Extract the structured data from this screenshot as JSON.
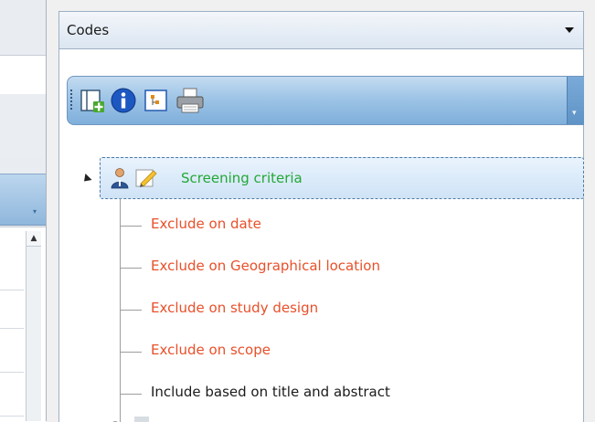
{
  "codes_panel": {
    "title": "Codes",
    "toolbar": [
      {
        "icon": "add-code-icon"
      },
      {
        "icon": "info-icon"
      },
      {
        "icon": "tree-view-icon"
      },
      {
        "icon": "print-icon"
      }
    ],
    "tree": {
      "root": {
        "label": "Screening criteria",
        "color": "#22a836"
      },
      "children": [
        {
          "label": "Exclude on date",
          "color": "#e8502a"
        },
        {
          "label": "Exclude on Geographical location",
          "color": "#e8502a"
        },
        {
          "label": "Exclude on study design",
          "color": "#e8502a"
        },
        {
          "label": "Exclude on scope",
          "color": "#e8502a"
        },
        {
          "label": "Include based on title and abstract",
          "color": "#1b1b1b"
        }
      ]
    }
  }
}
